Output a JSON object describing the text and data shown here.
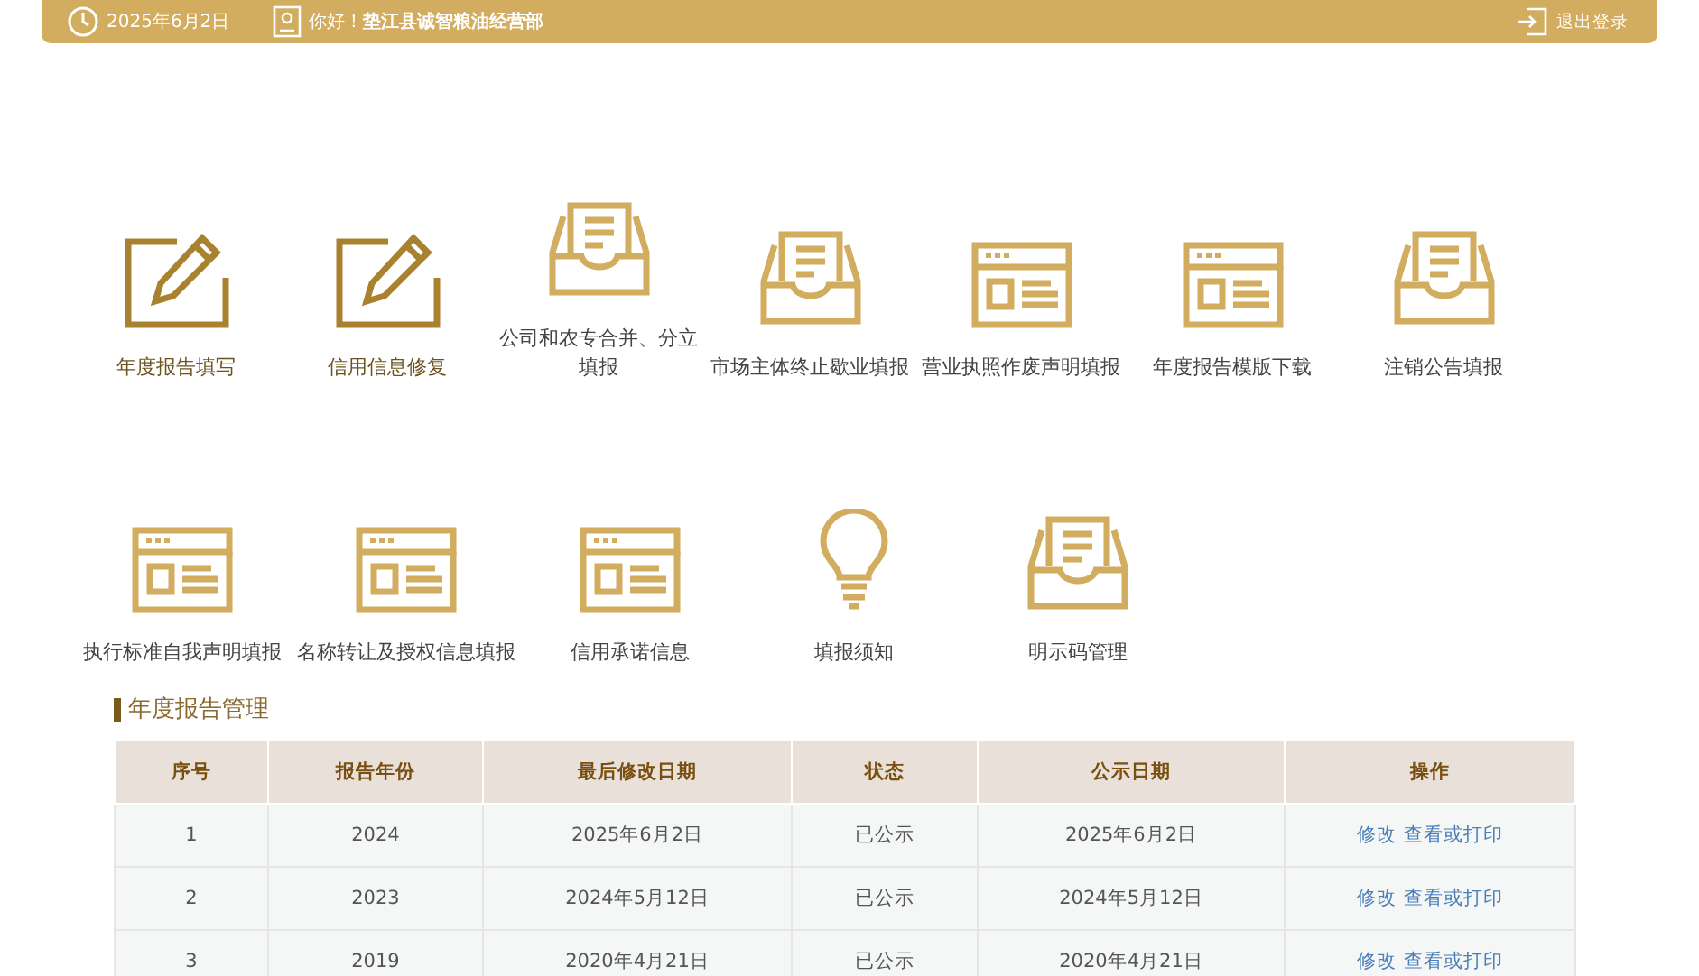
{
  "header": {
    "date": "2025年6月2日",
    "greeting": "你好！**垫江县诚智粮油经营部**",
    "logout": "退出登录"
  },
  "menu_rows": [
    [
      {
        "kind": "pencil",
        "label": "年度报告填写"
      },
      {
        "kind": "pencil",
        "label": "信用信息修复"
      },
      {
        "kind": "tray",
        "label": "公司和农专合并、分立填报"
      },
      {
        "kind": "tray",
        "label": "市场主体终止歇业填报"
      },
      {
        "kind": "form",
        "label": "营业执照作废声明填报"
      },
      {
        "kind": "form",
        "label": "年度报告模版下载"
      },
      {
        "kind": "tray",
        "label": "注销公告填报"
      }
    ],
    [
      {
        "kind": "form",
        "label": "执行标准自我声明填报"
      },
      {
        "kind": "form",
        "label": "名称转让及授权信息填报"
      },
      {
        "kind": "form",
        "label": "信用承诺信息"
      },
      {
        "kind": "bulb",
        "label": "填报须知"
      },
      {
        "kind": "tray",
        "label": "明示码管理"
      }
    ]
  ],
  "section_title": "年度报告管理",
  "table": {
    "columns": [
      "序号",
      "报告年份",
      "最后修改日期",
      "状态",
      "公示日期",
      "操作"
    ],
    "rows": [
      {
        "cells": [
          "1",
          "2024",
          "2025年6月2日",
          "已公示",
          "2025年6月2日"
        ],
        "actions": [
          "修改",
          "查看或打印"
        ]
      },
      {
        "cells": [
          "2",
          "2023",
          "2024年5月12日",
          "已公示",
          "2024年5月12日"
        ],
        "actions": [
          "修改",
          "查看或打印"
        ]
      },
      {
        "cells": [
          "3",
          "2019",
          "2020年4月21日",
          "已公示",
          "2020年4月21日"
        ],
        "actions": [
          "修改",
          "查看或打印"
        ]
      }
    ]
  }
}
